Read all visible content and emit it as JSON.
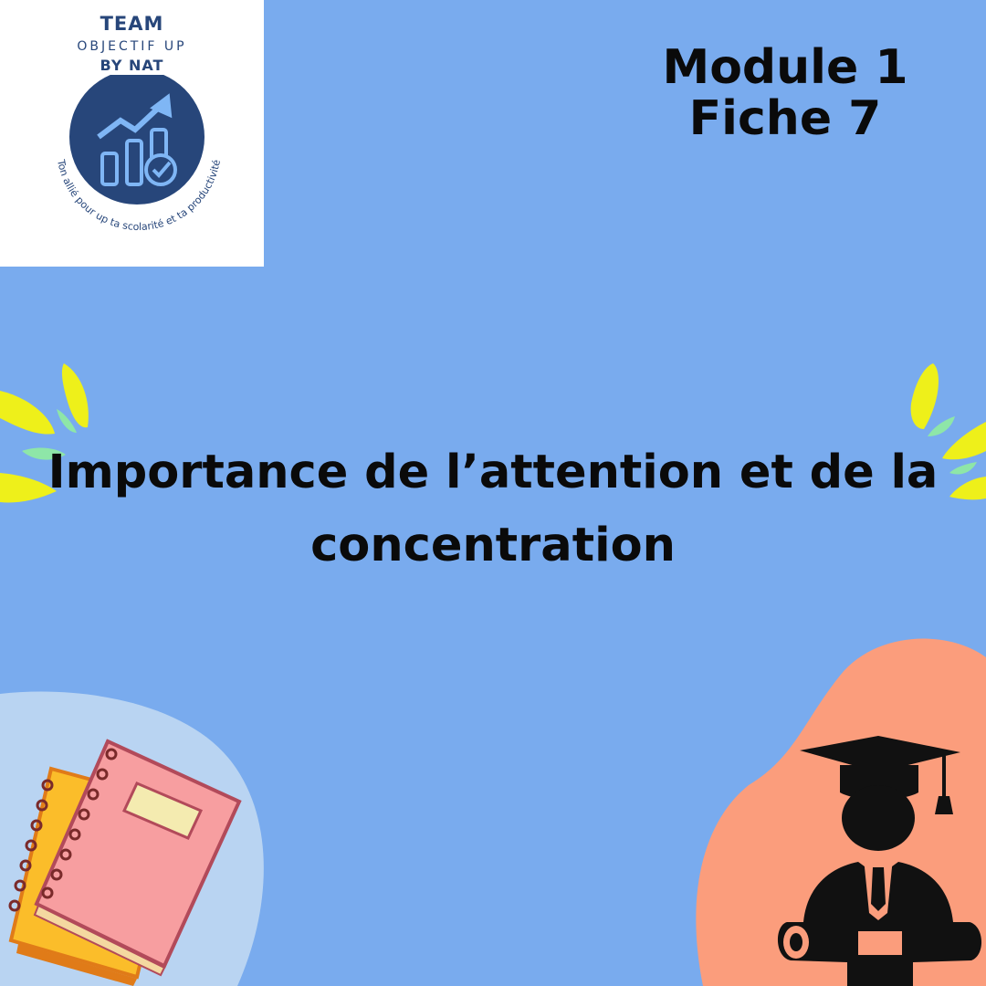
{
  "logo": {
    "team": "TEAM",
    "objectif": "OBJECTIF UP",
    "by_nat": "BY NAT",
    "tagline": "Ton allié pour up ta scolarité et ta productivité"
  },
  "header": {
    "module": "Module 1",
    "fiche": "Fiche 7"
  },
  "title": {
    "line1": "Importance de l’attention et de la",
    "line2": "concentration"
  },
  "colors": {
    "background": "#79abee",
    "logo_navy": "#27467a",
    "accent_yellow": "#eef01a",
    "accent_green": "#8ee6a8",
    "blob_salmon": "#fb9d7c",
    "blob_lightblue": "#b9d4f2",
    "notebook_pink": "#f79ea0",
    "notebook_yellow": "#fbbd2a"
  },
  "icons": [
    "growth-chart-icon",
    "check-badge-icon",
    "graduate-icon",
    "notebook-icon",
    "diploma-icon"
  ]
}
